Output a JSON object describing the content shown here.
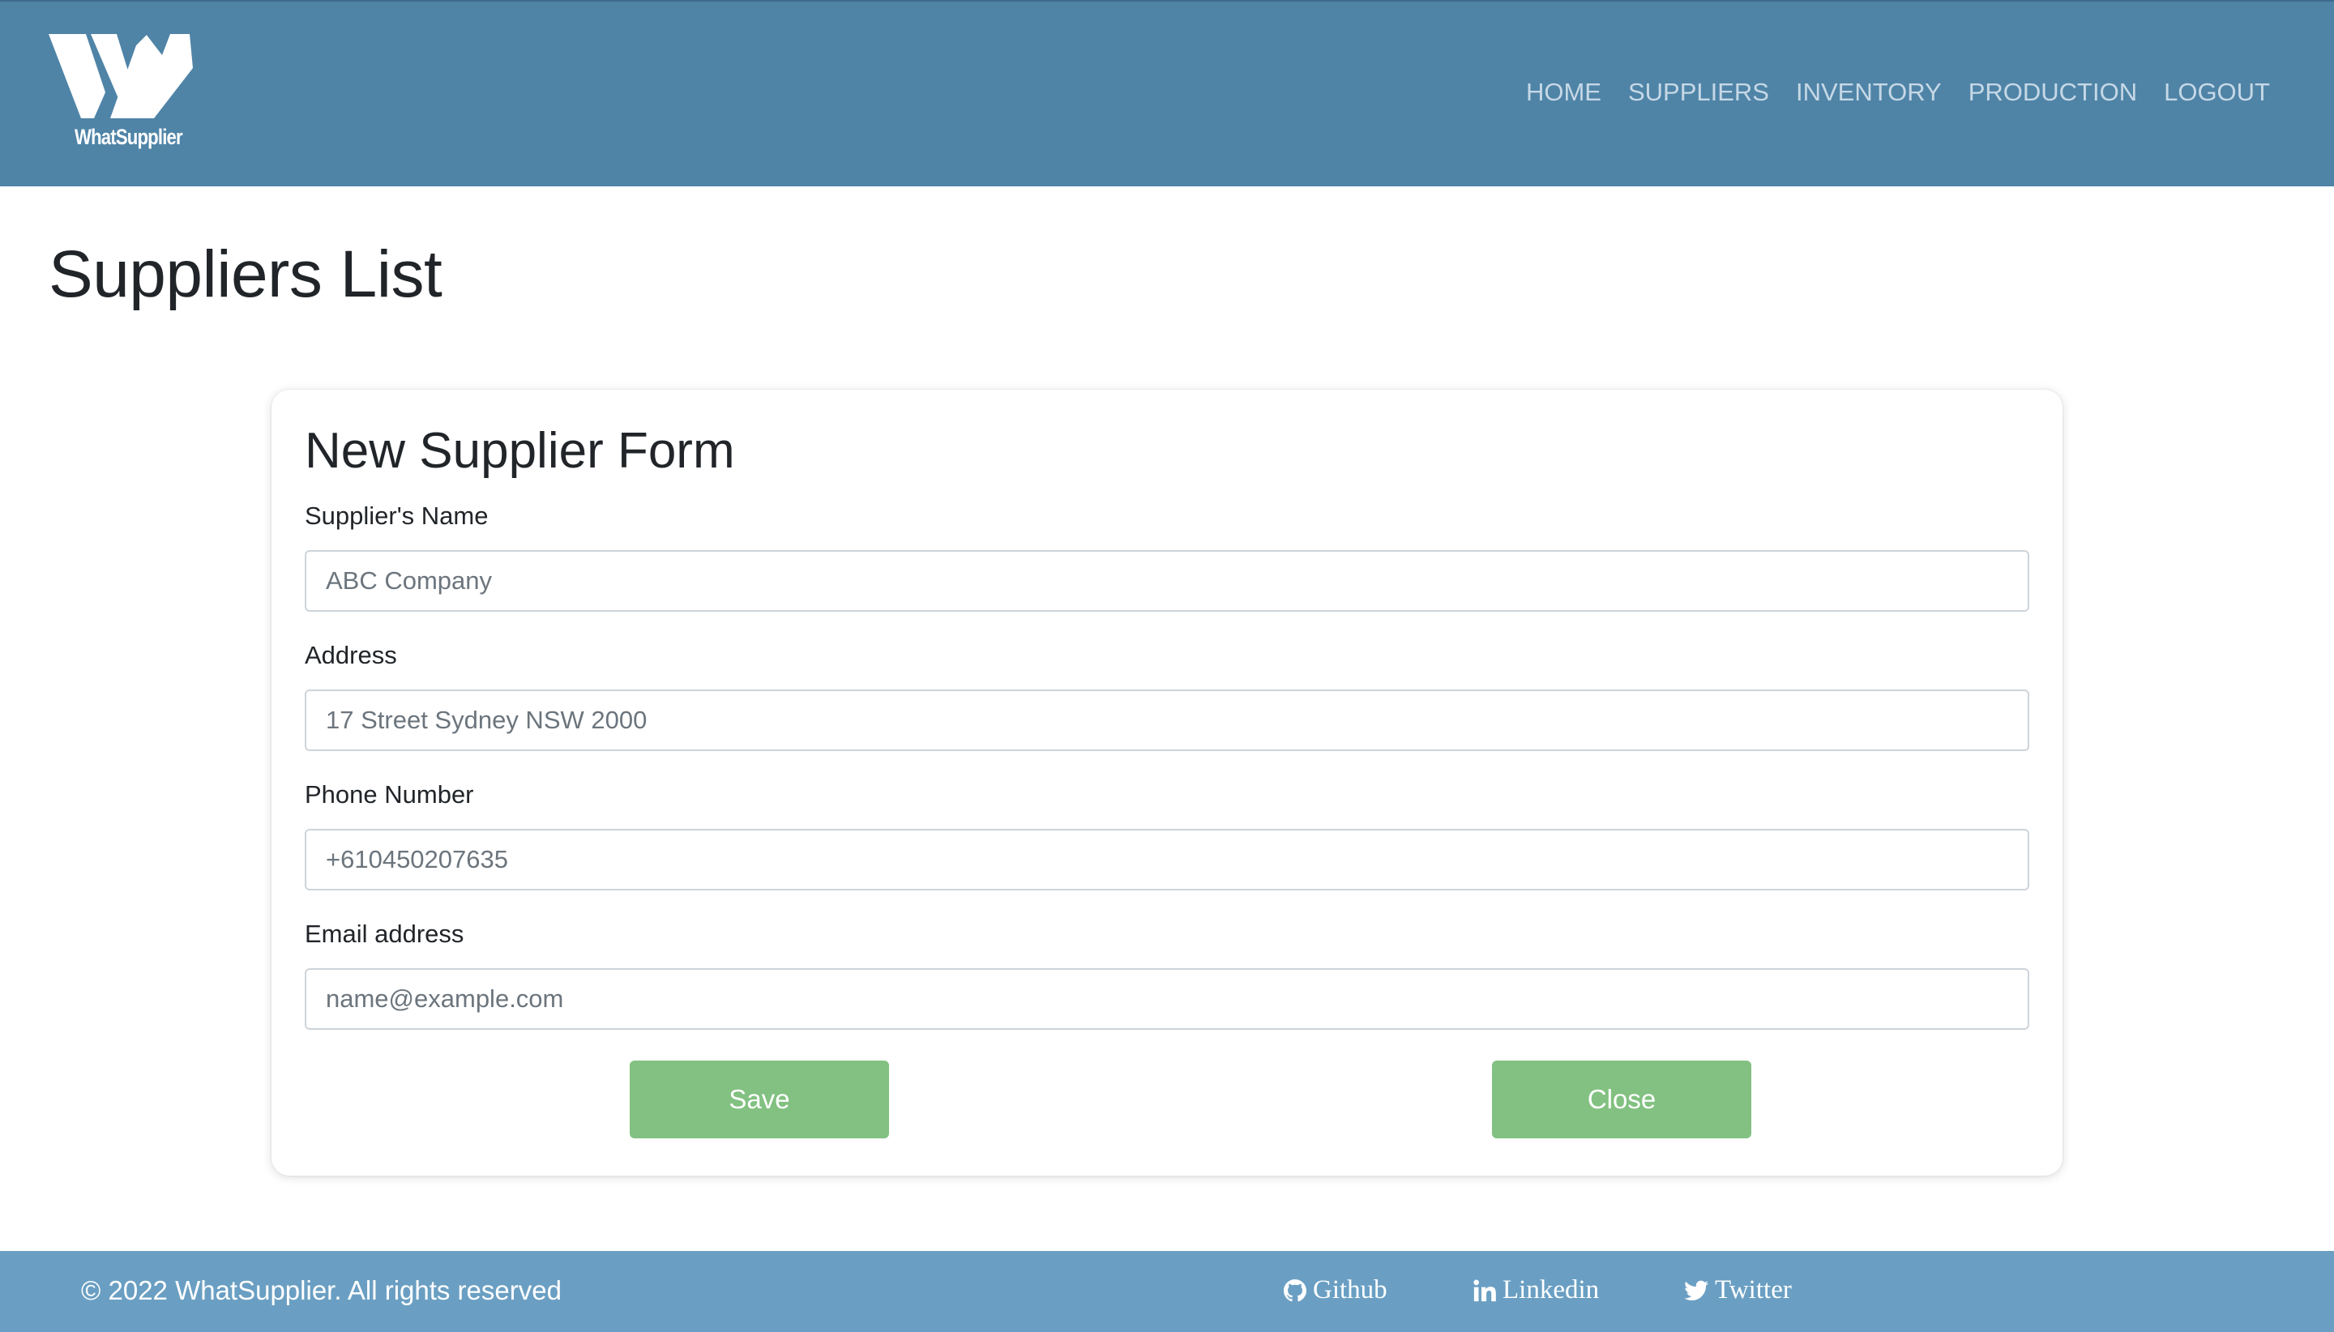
{
  "brand": {
    "logo_text": "WhatSupplier"
  },
  "nav": {
    "items": [
      {
        "label": "HOME"
      },
      {
        "label": "SUPPLIERS"
      },
      {
        "label": "INVENTORY"
      },
      {
        "label": "PRODUCTION"
      },
      {
        "label": "LOGOUT"
      }
    ]
  },
  "page": {
    "title": "Suppliers List"
  },
  "form": {
    "title": "New Supplier Form",
    "fields": [
      {
        "label": "Supplier's Name",
        "value": "",
        "placeholder": "ABC Company"
      },
      {
        "label": "Address",
        "value": "",
        "placeholder": "17 Street Sydney NSW 2000"
      },
      {
        "label": "Phone Number",
        "value": "",
        "placeholder": "+610450207635"
      },
      {
        "label": "Email address",
        "value": "",
        "placeholder": "name@example.com"
      }
    ],
    "save_label": "Save",
    "close_label": "Close"
  },
  "footer": {
    "copyright": "© 2022 WhatSupplier. All rights reserved",
    "links": [
      {
        "label": "Github",
        "icon": "github-icon"
      },
      {
        "label": "Linkedin",
        "icon": "linkedin-icon"
      },
      {
        "label": "Twitter",
        "icon": "twitter-icon"
      }
    ]
  },
  "colors": {
    "header_bg": "#4f84a7",
    "nav_text": "#c6d8e6",
    "button_bg": "#82c181",
    "footer_bg": "#6a9fc3"
  }
}
